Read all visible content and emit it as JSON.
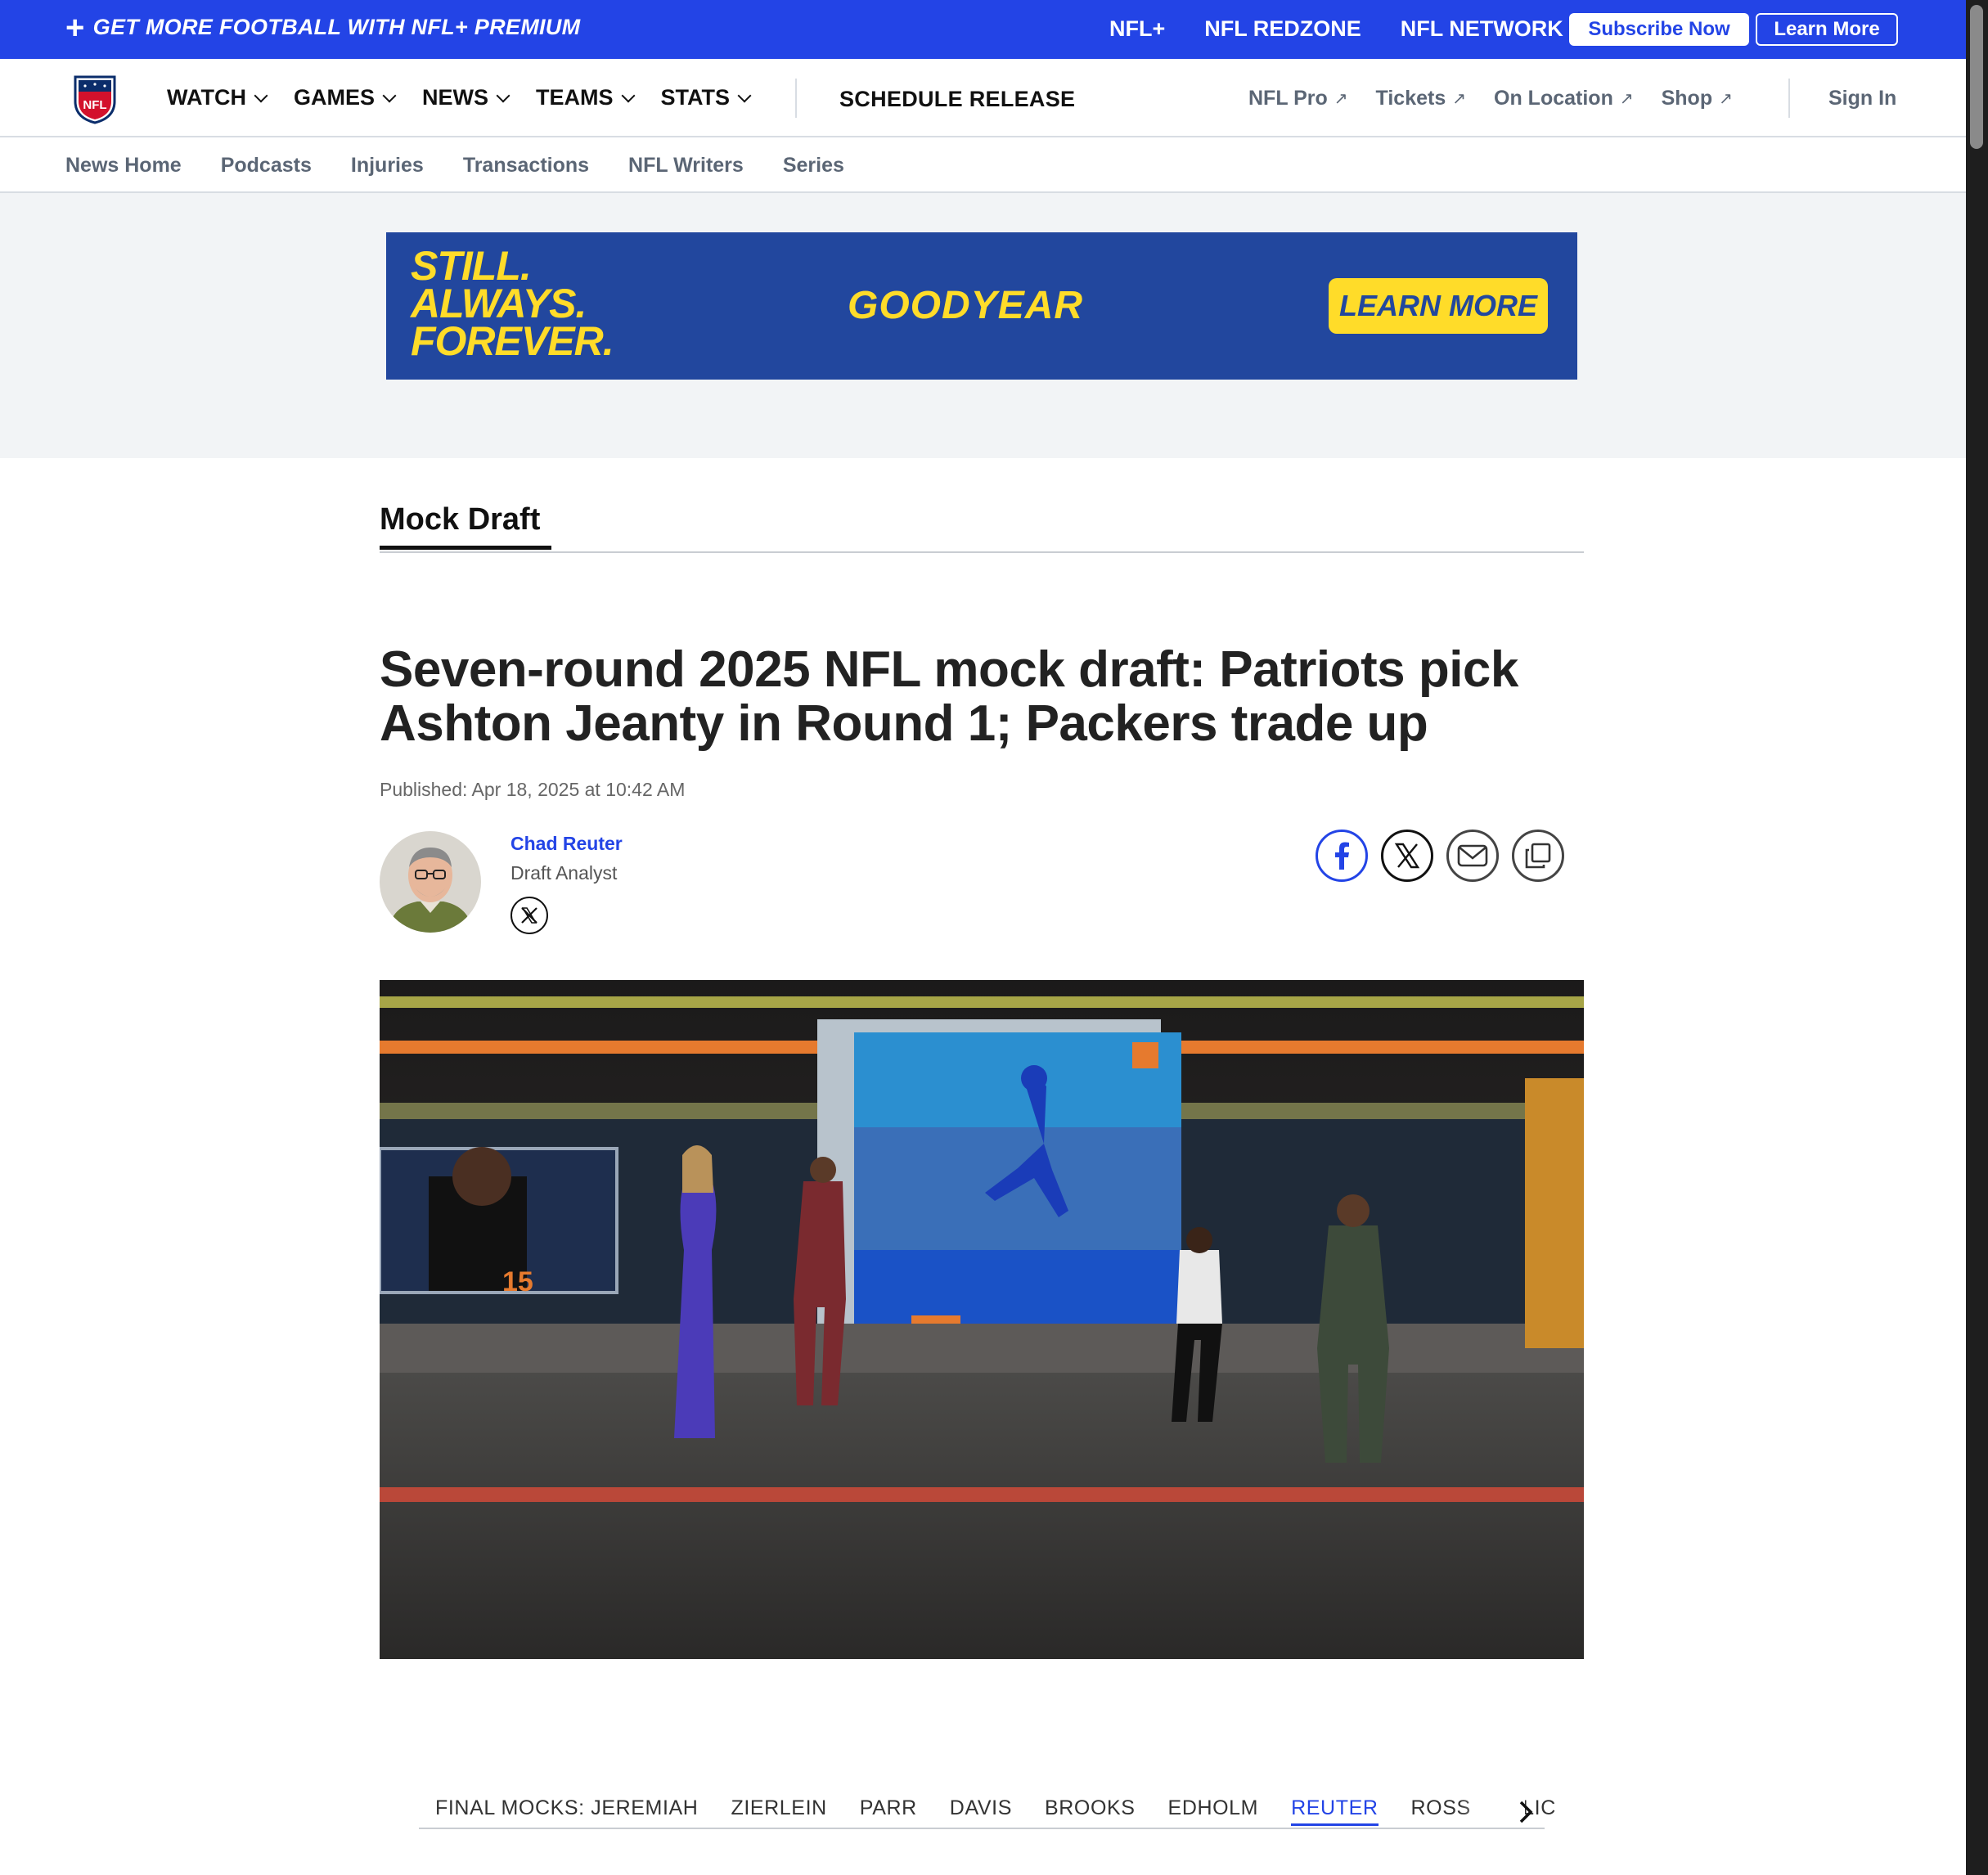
{
  "promo": {
    "tagline": "GET MORE FOOTBALL WITH NFL+ PREMIUM",
    "links": [
      "NFL+",
      "NFL REDZONE",
      "NFL NETWORK"
    ],
    "subscribe_label": "Subscribe Now",
    "learn_label": "Learn More",
    "bg_color": "#2344e6"
  },
  "nav": {
    "items": [
      "WATCH",
      "GAMES",
      "NEWS",
      "TEAMS",
      "STATS"
    ],
    "schedule_label": "SCHEDULE RELEASE",
    "right_links": [
      "NFL Pro",
      "Tickets",
      "On Location",
      "Shop"
    ],
    "signin_label": "Sign In"
  },
  "subnav": {
    "items": [
      "News Home",
      "Podcasts",
      "Injuries",
      "Transactions",
      "NFL Writers",
      "Series"
    ]
  },
  "ad": {
    "tagline": [
      "STILL.",
      "ALWAYS.",
      "FOREVER."
    ],
    "brand": "GOODYEAR",
    "cta": "LEARN MORE",
    "bg_color": "#22479e",
    "accent_color": "#ffdc29"
  },
  "article": {
    "section": "Mock Draft",
    "headline": "Seven-round 2025 NFL mock draft: Patriots pick Ashton Jeanty in Round 1; Packers trade up",
    "published": "Published: Apr 18, 2025 at 10:42 AM",
    "author": {
      "name": "Chad Reuter",
      "role": "Draft Analyst"
    },
    "share_icons": [
      "facebook-icon",
      "x-icon",
      "email-icon",
      "copy-link-icon"
    ],
    "hero_jersey_number": "15"
  },
  "mock_tabs": {
    "items": [
      "FINAL MOCKS: JEREMIAH",
      "ZIERLEIN",
      "PARR",
      "DAVIS",
      "BROOKS",
      "EDHOLM",
      "REUTER",
      "ROSS",
      "FILIC"
    ],
    "active": "REUTER"
  }
}
